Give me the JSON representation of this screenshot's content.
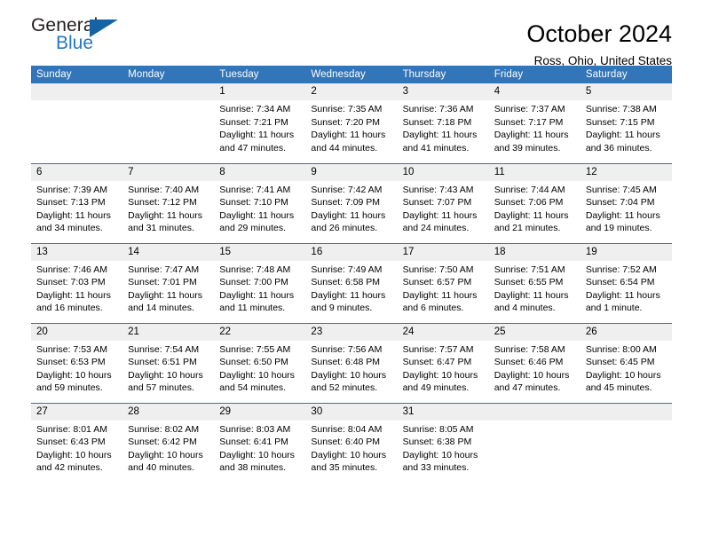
{
  "brand": {
    "name_part1": "General",
    "name_part2": "Blue",
    "triangle_color": "#1464a5",
    "accent_color": "#1f7ac4"
  },
  "header": {
    "title": "October 2024",
    "location": "Ross, Ohio, United States"
  },
  "theme": {
    "header_row_bg": "#3275b8",
    "daynum_bg": "#efefef",
    "row_divider": "#3275b8",
    "page_bg": "#ffffff",
    "text": "#000000"
  },
  "weekdays": [
    "Sunday",
    "Monday",
    "Tuesday",
    "Wednesday",
    "Thursday",
    "Friday",
    "Saturday"
  ],
  "weeks": [
    [
      {
        "day": "",
        "blank": true
      },
      {
        "day": "",
        "blank": true
      },
      {
        "day": "1",
        "sunrise": "Sunrise: 7:34 AM",
        "sunset": "Sunset: 7:21 PM",
        "daylight_line1": "Daylight: 11 hours",
        "daylight_line2": "and 47 minutes."
      },
      {
        "day": "2",
        "sunrise": "Sunrise: 7:35 AM",
        "sunset": "Sunset: 7:20 PM",
        "daylight_line1": "Daylight: 11 hours",
        "daylight_line2": "and 44 minutes."
      },
      {
        "day": "3",
        "sunrise": "Sunrise: 7:36 AM",
        "sunset": "Sunset: 7:18 PM",
        "daylight_line1": "Daylight: 11 hours",
        "daylight_line2": "and 41 minutes."
      },
      {
        "day": "4",
        "sunrise": "Sunrise: 7:37 AM",
        "sunset": "Sunset: 7:17 PM",
        "daylight_line1": "Daylight: 11 hours",
        "daylight_line2": "and 39 minutes."
      },
      {
        "day": "5",
        "sunrise": "Sunrise: 7:38 AM",
        "sunset": "Sunset: 7:15 PM",
        "daylight_line1": "Daylight: 11 hours",
        "daylight_line2": "and 36 minutes."
      }
    ],
    [
      {
        "day": "6",
        "sunrise": "Sunrise: 7:39 AM",
        "sunset": "Sunset: 7:13 PM",
        "daylight_line1": "Daylight: 11 hours",
        "daylight_line2": "and 34 minutes."
      },
      {
        "day": "7",
        "sunrise": "Sunrise: 7:40 AM",
        "sunset": "Sunset: 7:12 PM",
        "daylight_line1": "Daylight: 11 hours",
        "daylight_line2": "and 31 minutes."
      },
      {
        "day": "8",
        "sunrise": "Sunrise: 7:41 AM",
        "sunset": "Sunset: 7:10 PM",
        "daylight_line1": "Daylight: 11 hours",
        "daylight_line2": "and 29 minutes."
      },
      {
        "day": "9",
        "sunrise": "Sunrise: 7:42 AM",
        "sunset": "Sunset: 7:09 PM",
        "daylight_line1": "Daylight: 11 hours",
        "daylight_line2": "and 26 minutes."
      },
      {
        "day": "10",
        "sunrise": "Sunrise: 7:43 AM",
        "sunset": "Sunset: 7:07 PM",
        "daylight_line1": "Daylight: 11 hours",
        "daylight_line2": "and 24 minutes."
      },
      {
        "day": "11",
        "sunrise": "Sunrise: 7:44 AM",
        "sunset": "Sunset: 7:06 PM",
        "daylight_line1": "Daylight: 11 hours",
        "daylight_line2": "and 21 minutes."
      },
      {
        "day": "12",
        "sunrise": "Sunrise: 7:45 AM",
        "sunset": "Sunset: 7:04 PM",
        "daylight_line1": "Daylight: 11 hours",
        "daylight_line2": "and 19 minutes."
      }
    ],
    [
      {
        "day": "13",
        "sunrise": "Sunrise: 7:46 AM",
        "sunset": "Sunset: 7:03 PM",
        "daylight_line1": "Daylight: 11 hours",
        "daylight_line2": "and 16 minutes."
      },
      {
        "day": "14",
        "sunrise": "Sunrise: 7:47 AM",
        "sunset": "Sunset: 7:01 PM",
        "daylight_line1": "Daylight: 11 hours",
        "daylight_line2": "and 14 minutes."
      },
      {
        "day": "15",
        "sunrise": "Sunrise: 7:48 AM",
        "sunset": "Sunset: 7:00 PM",
        "daylight_line1": "Daylight: 11 hours",
        "daylight_line2": "and 11 minutes."
      },
      {
        "day": "16",
        "sunrise": "Sunrise: 7:49 AM",
        "sunset": "Sunset: 6:58 PM",
        "daylight_line1": "Daylight: 11 hours",
        "daylight_line2": "and 9 minutes."
      },
      {
        "day": "17",
        "sunrise": "Sunrise: 7:50 AM",
        "sunset": "Sunset: 6:57 PM",
        "daylight_line1": "Daylight: 11 hours",
        "daylight_line2": "and 6 minutes."
      },
      {
        "day": "18",
        "sunrise": "Sunrise: 7:51 AM",
        "sunset": "Sunset: 6:55 PM",
        "daylight_line1": "Daylight: 11 hours",
        "daylight_line2": "and 4 minutes."
      },
      {
        "day": "19",
        "sunrise": "Sunrise: 7:52 AM",
        "sunset": "Sunset: 6:54 PM",
        "daylight_line1": "Daylight: 11 hours",
        "daylight_line2": "and 1 minute."
      }
    ],
    [
      {
        "day": "20",
        "sunrise": "Sunrise: 7:53 AM",
        "sunset": "Sunset: 6:53 PM",
        "daylight_line1": "Daylight: 10 hours",
        "daylight_line2": "and 59 minutes."
      },
      {
        "day": "21",
        "sunrise": "Sunrise: 7:54 AM",
        "sunset": "Sunset: 6:51 PM",
        "daylight_line1": "Daylight: 10 hours",
        "daylight_line2": "and 57 minutes."
      },
      {
        "day": "22",
        "sunrise": "Sunrise: 7:55 AM",
        "sunset": "Sunset: 6:50 PM",
        "daylight_line1": "Daylight: 10 hours",
        "daylight_line2": "and 54 minutes."
      },
      {
        "day": "23",
        "sunrise": "Sunrise: 7:56 AM",
        "sunset": "Sunset: 6:48 PM",
        "daylight_line1": "Daylight: 10 hours",
        "daylight_line2": "and 52 minutes."
      },
      {
        "day": "24",
        "sunrise": "Sunrise: 7:57 AM",
        "sunset": "Sunset: 6:47 PM",
        "daylight_line1": "Daylight: 10 hours",
        "daylight_line2": "and 49 minutes."
      },
      {
        "day": "25",
        "sunrise": "Sunrise: 7:58 AM",
        "sunset": "Sunset: 6:46 PM",
        "daylight_line1": "Daylight: 10 hours",
        "daylight_line2": "and 47 minutes."
      },
      {
        "day": "26",
        "sunrise": "Sunrise: 8:00 AM",
        "sunset": "Sunset: 6:45 PM",
        "daylight_line1": "Daylight: 10 hours",
        "daylight_line2": "and 45 minutes."
      }
    ],
    [
      {
        "day": "27",
        "sunrise": "Sunrise: 8:01 AM",
        "sunset": "Sunset: 6:43 PM",
        "daylight_line1": "Daylight: 10 hours",
        "daylight_line2": "and 42 minutes."
      },
      {
        "day": "28",
        "sunrise": "Sunrise: 8:02 AM",
        "sunset": "Sunset: 6:42 PM",
        "daylight_line1": "Daylight: 10 hours",
        "daylight_line2": "and 40 minutes."
      },
      {
        "day": "29",
        "sunrise": "Sunrise: 8:03 AM",
        "sunset": "Sunset: 6:41 PM",
        "daylight_line1": "Daylight: 10 hours",
        "daylight_line2": "and 38 minutes."
      },
      {
        "day": "30",
        "sunrise": "Sunrise: 8:04 AM",
        "sunset": "Sunset: 6:40 PM",
        "daylight_line1": "Daylight: 10 hours",
        "daylight_line2": "and 35 minutes."
      },
      {
        "day": "31",
        "sunrise": "Sunrise: 8:05 AM",
        "sunset": "Sunset: 6:38 PM",
        "daylight_line1": "Daylight: 10 hours",
        "daylight_line2": "and 33 minutes."
      },
      {
        "day": "",
        "blank": true
      },
      {
        "day": "",
        "blank": true
      }
    ]
  ]
}
